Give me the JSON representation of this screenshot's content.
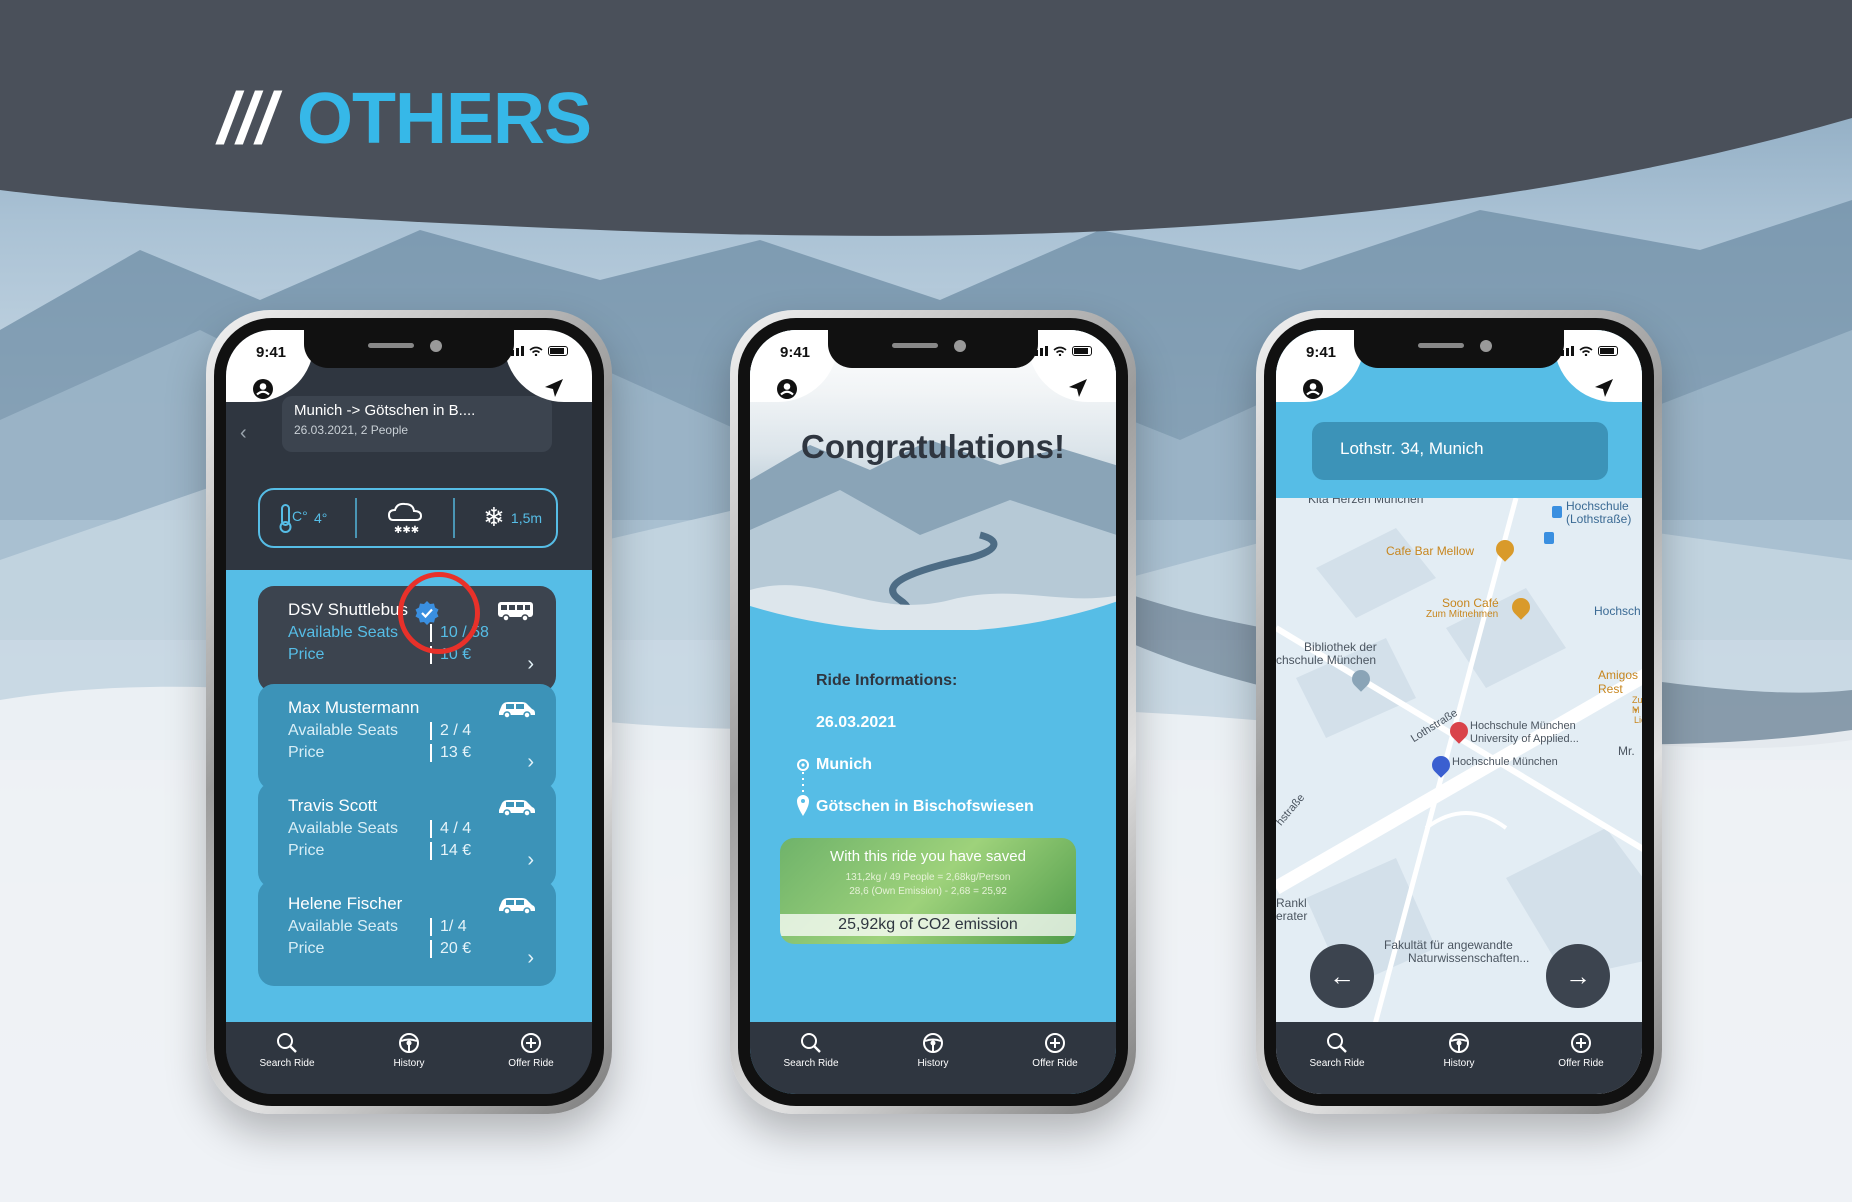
{
  "heading": {
    "prefix": "///",
    "text": "OTHERS"
  },
  "colors": {
    "accent": "#56bde6",
    "dark": "#2f3640",
    "banner": "#4a505a",
    "verified": "#3a8fe0",
    "highlight": "#e8312a"
  },
  "status_bar": {
    "time": "9:41"
  },
  "tabbar": {
    "items": [
      {
        "label": "Search Ride",
        "icon": "search-icon"
      },
      {
        "label": "History",
        "icon": "steering-wheel-icon"
      },
      {
        "label": "Offer Ride",
        "icon": "plus-circle-icon"
      }
    ]
  },
  "phone1": {
    "route": "Munich -> Götschen in B....",
    "subtitle": "26.03.2021, 2 People",
    "weather": {
      "temperature": "4°",
      "condition_icon": "snow-cloud-icon",
      "snow_depth": "1,5m"
    },
    "rides": [
      {
        "name": "DSV Shuttlebus",
        "seats_label": "Available Seats",
        "seats": "10 / 58",
        "price_label": "Price",
        "price": "10 €",
        "vehicle": "bus-icon",
        "verified": true
      },
      {
        "name": "Max Mustermann",
        "seats_label": "Available Seats",
        "seats": "2 / 4",
        "price_label": "Price",
        "price": "13 €",
        "vehicle": "car-icon"
      },
      {
        "name": "Travis Scott",
        "seats_label": "Available Seats",
        "seats": "4 / 4",
        "price_label": "Price",
        "price": "14 €",
        "vehicle": "car-icon"
      },
      {
        "name": "Helene Fischer",
        "seats_label": "Available Seats",
        "seats": "1/ 4",
        "price_label": "Price",
        "price": "20 €",
        "vehicle": "car-icon"
      }
    ]
  },
  "phone2": {
    "title": "Congratulations!",
    "info_title": "Ride Informations:",
    "date": "26.03.2021",
    "from": "Munich",
    "to": "Götschen in Bischofswiesen",
    "saved": {
      "headline": "With this ride you have saved",
      "line1": "131,2kg / 49 People = 2,68kg/Person",
      "line2": "28,6 (Own Emission) - 2,68 = 25,92",
      "result": "25,92kg of CO2 emission"
    }
  },
  "phone3": {
    "address": "Lothstr. 34, Munich",
    "map_labels": {
      "top": "Kita Herzen München",
      "station": "Hochschule (Lothstraße)",
      "cafe1": "Cafe Bar Mellow",
      "cafe2": "Soon Café",
      "cafe2_sub": "Zum Mitnehmen",
      "right1": "Hochsch",
      "library1": "Bibliothek der",
      "library2": "chschule München",
      "amigos": "Amigos Rest",
      "amigos2": "M",
      "amigos3": "Zum M",
      "amigos4": "• Lie",
      "street1": "Lothstraße",
      "uni1": "Hochschule München",
      "uni2": "University of Applied...",
      "uni3": "Hochschule München",
      "mr": "Mr.",
      "street2": "hstraße",
      "rankl1": "Rankl",
      "rankl2": "erater",
      "faculty1": "Fakultät für angewandte",
      "faculty2": "Naturwissenschaften..."
    }
  }
}
